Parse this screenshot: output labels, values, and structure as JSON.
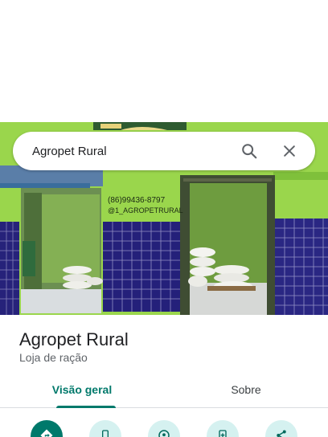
{
  "search": {
    "query": "Agropet Rural"
  },
  "storefront": {
    "phone": "(86)99436-8797",
    "handle": "@1_AGROPETRURAL"
  },
  "place": {
    "name": "Agropet Rural",
    "category": "Loja de ração"
  },
  "tabs": [
    {
      "label": "Visão geral",
      "active": true
    },
    {
      "label": "Sobre",
      "active": false
    }
  ],
  "actions": [
    {
      "icon": "directions-icon"
    },
    {
      "icon": "phone-icon"
    },
    {
      "icon": "location-pin-icon"
    },
    {
      "icon": "add-to-phone-icon"
    },
    {
      "icon": "share-icon"
    }
  ],
  "colors": {
    "accent": "#00796b",
    "action_bg": "#d5f1f0"
  }
}
